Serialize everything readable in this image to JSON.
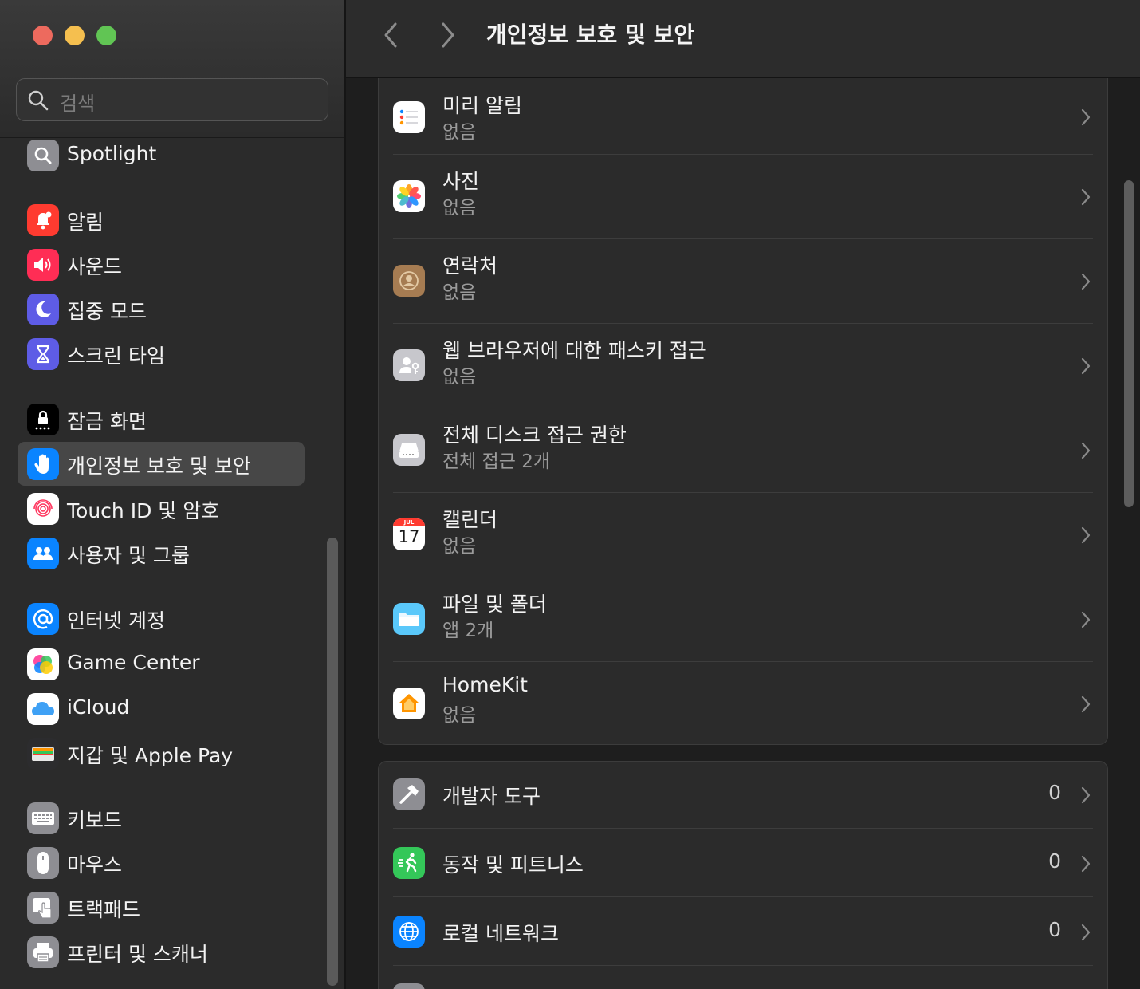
{
  "window": {
    "title": "개인정보 보호 및 보안"
  },
  "search": {
    "placeholder": "검색"
  },
  "sidebar": {
    "items": [
      {
        "label": "Spotlight",
        "icon": "spotlight-icon",
        "color": "#8e8e93"
      },
      {
        "label": "알림",
        "icon": "notifications-icon",
        "color": "#ff3b30"
      },
      {
        "label": "사운드",
        "icon": "sound-icon",
        "color": "#ff2d55"
      },
      {
        "label": "집중 모드",
        "icon": "focus-moon-icon",
        "color": "#5e5ce6"
      },
      {
        "label": "스크린 타임",
        "icon": "hourglass-icon",
        "color": "#5e5ce6"
      },
      {
        "label": "잠금 화면",
        "icon": "lock-screen-icon",
        "color": "#000000"
      },
      {
        "label": "개인정보 보호 및 보안",
        "icon": "privacy-hand-icon",
        "color": "#0a84ff",
        "selected": true
      },
      {
        "label": "Touch ID 및 암호",
        "icon": "fingerprint-icon",
        "color": "#ffffff"
      },
      {
        "label": "사용자 및 그룹",
        "icon": "users-icon",
        "color": "#0a84ff"
      },
      {
        "label": "인터넷 계정",
        "icon": "at-sign-icon",
        "color": "#0a84ff"
      },
      {
        "label": "Game Center",
        "icon": "game-center-icon",
        "color": "#ffffff"
      },
      {
        "label": "iCloud",
        "icon": "icloud-icon",
        "color": "#ffffff"
      },
      {
        "label": "지갑 및 Apple Pay",
        "icon": "wallet-icon",
        "color": "#2c2c2e"
      },
      {
        "label": "키보드",
        "icon": "keyboard-icon",
        "color": "#8e8e93"
      },
      {
        "label": "마우스",
        "icon": "mouse-icon",
        "color": "#8e8e93"
      },
      {
        "label": "트랙패드",
        "icon": "trackpad-icon",
        "color": "#8e8e93"
      },
      {
        "label": "프린터 및 스캐너",
        "icon": "printer-icon",
        "color": "#8e8e93"
      }
    ]
  },
  "main": {
    "group1": [
      {
        "title": "미리 알림",
        "subtitle": "없음",
        "icon": "reminders-icon"
      },
      {
        "title": "사진",
        "subtitle": "없음",
        "icon": "photos-icon"
      },
      {
        "title": "연락처",
        "subtitle": "없음",
        "icon": "contacts-icon"
      },
      {
        "title": "웹 브라우저에 대한 패스키 접근",
        "subtitle": "없음",
        "icon": "passkey-icon"
      },
      {
        "title": "전체 디스크 접근 권한",
        "subtitle": "전체 접근 2개",
        "icon": "disk-icon"
      },
      {
        "title": "캘린더",
        "subtitle": "없음",
        "icon": "calendar-icon",
        "cal_month": "JUL",
        "cal_day": "17"
      },
      {
        "title": "파일 및 폴더",
        "subtitle": "앱 2개",
        "icon": "folder-icon"
      },
      {
        "title": "HomeKit",
        "subtitle": "없음",
        "icon": "homekit-icon"
      }
    ],
    "group2": [
      {
        "title": "개발자 도구",
        "count": "0",
        "icon": "developer-tools-icon"
      },
      {
        "title": "동작 및 피트니스",
        "count": "0",
        "icon": "motion-fitness-icon"
      },
      {
        "title": "로컬 네트워크",
        "count": "0",
        "icon": "local-network-icon"
      }
    ]
  },
  "colors": {
    "accent": "#0a84ff",
    "close": "#ed6a5e",
    "minimize": "#f5bf4f",
    "maximize": "#61c554"
  }
}
